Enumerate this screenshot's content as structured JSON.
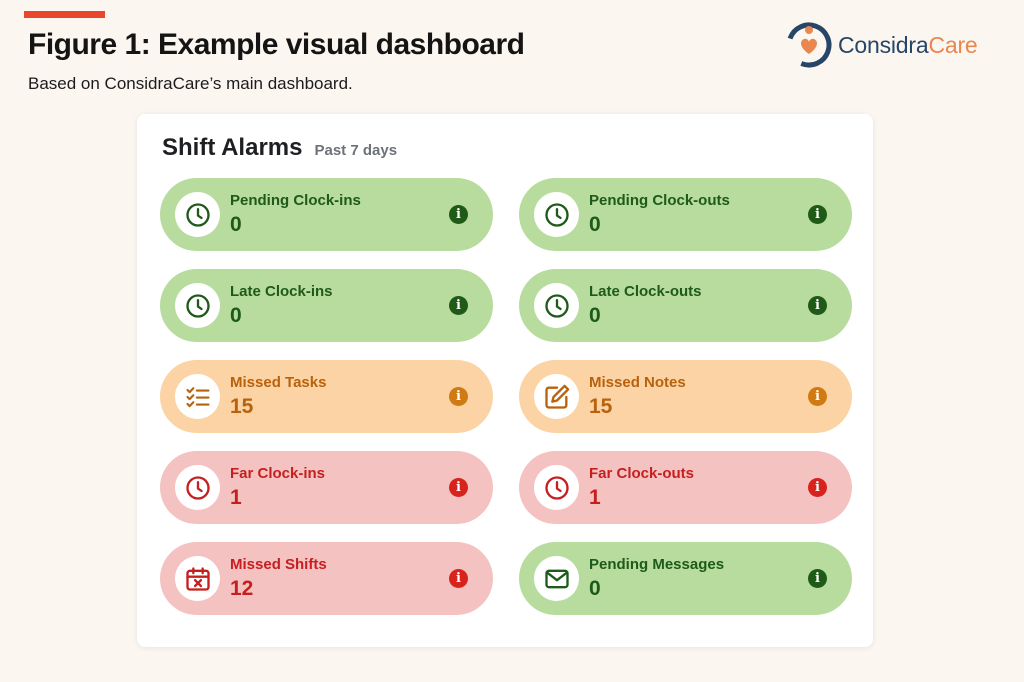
{
  "header": {
    "title": "Figure 1: Example visual dashboard",
    "subtitle": "Based on ConsidraCare’s main dashboard."
  },
  "logo": {
    "icon": "considracare-logo-icon",
    "name_part1": "Considra",
    "name_part2": "Care"
  },
  "card": {
    "title": "Shift Alarms",
    "period": "Past 7 days"
  },
  "colors": {
    "accent_bar": "#e8472b",
    "green_tile": "#b7dc9e",
    "green_text": "#1e5a1a",
    "orange_tile": "#fbd3a4",
    "orange_text": "#b8620d",
    "red_tile": "#f4c3c1",
    "red_text": "#c61f1f"
  },
  "tiles": [
    {
      "label": "Pending Clock-ins",
      "value": "0",
      "status": "green",
      "icon": "clock-icon"
    },
    {
      "label": "Pending Clock-outs",
      "value": "0",
      "status": "green",
      "icon": "clock-icon"
    },
    {
      "label": "Late Clock-ins",
      "value": "0",
      "status": "green",
      "icon": "clock-icon"
    },
    {
      "label": "Late Clock-outs",
      "value": "0",
      "status": "green",
      "icon": "clock-icon"
    },
    {
      "label": "Missed Tasks",
      "value": "15",
      "status": "orange",
      "icon": "checklist-icon"
    },
    {
      "label": "Missed Notes",
      "value": "15",
      "status": "orange",
      "icon": "edit-note-icon"
    },
    {
      "label": "Far Clock-ins",
      "value": "1",
      "status": "red",
      "icon": "clock-icon"
    },
    {
      "label": "Far Clock-outs",
      "value": "1",
      "status": "red",
      "icon": "clock-icon"
    },
    {
      "label": "Missed Shifts",
      "value": "12",
      "status": "red",
      "icon": "calendar-x-icon"
    },
    {
      "label": "Pending Messages",
      "value": "0",
      "status": "green",
      "icon": "envelope-icon"
    }
  ],
  "info_glyph": "i"
}
